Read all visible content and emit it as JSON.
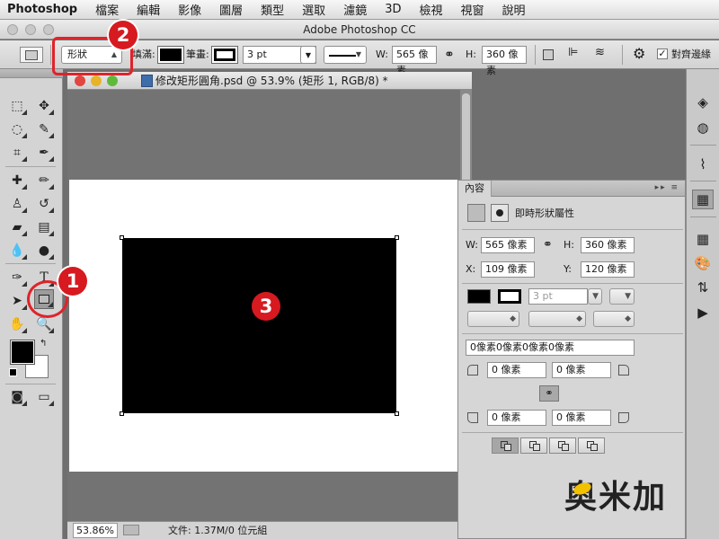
{
  "menubar": {
    "app": "Photoshop",
    "items": [
      "檔案",
      "編輯",
      "影像",
      "圖層",
      "類型",
      "選取",
      "濾鏡",
      "3D",
      "檢視",
      "視窗",
      "說明"
    ]
  },
  "window": {
    "title": "Adobe Photoshop CC"
  },
  "options": {
    "mode_value": "形狀",
    "fill_label": "填滿:",
    "stroke_label": "筆畫:",
    "stroke_width": "3 pt",
    "w_label": "W:",
    "w_value": "565 像素",
    "h_label": "H:",
    "h_value": "360 像素",
    "align_label": "對齊邊緣",
    "align_checked": true
  },
  "document": {
    "tab_title": "修改矩形圓角.psd @ 53.9% (矩形 1, RGB/8) *",
    "zoom": "53.86%",
    "doc_info": "文件: 1.37M/0 位元組"
  },
  "properties": {
    "tab": "內容",
    "subtitle": "即時形狀屬性",
    "w_label": "W:",
    "w_value": "565 像素",
    "h_label": "H:",
    "h_value": "360 像素",
    "x_label": "X:",
    "x_value": "109 像素",
    "y_label": "Y:",
    "y_value": "120 像素",
    "stroke_width": "3 pt",
    "radius_all": "0像素0像素0像素0像素",
    "r_tl": "0 像素",
    "r_tr": "0 像素",
    "r_bl": "0 像素",
    "r_br": "0 像素"
  },
  "annotations": {
    "one": "1",
    "two": "2",
    "three": "3"
  },
  "watermark": "奥米加",
  "colors": {
    "highlight": "#e0232a",
    "badge": "#d71920",
    "fill": "#000000"
  }
}
